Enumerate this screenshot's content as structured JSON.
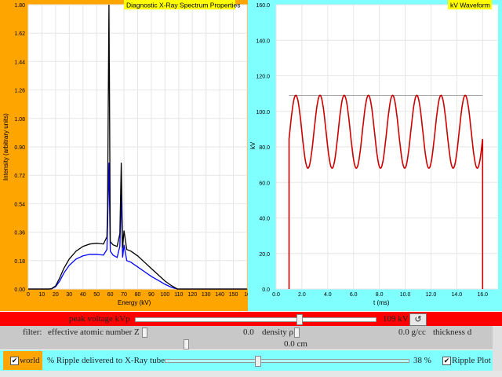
{
  "spectrum_plot": {
    "title": "Diagnostic X-Ray Spectrum Properties",
    "ylabel": "Intensity (arbitrary units)",
    "xlabel": "Energy (kV)",
    "background": "#ffa500",
    "title_bg": "#ffff00",
    "y_ticks": [
      "1.80",
      "1.62",
      "1.44",
      "1.26",
      "1.08",
      "0.90",
      "0.72",
      "0.54",
      "0.36",
      "0.18",
      "0.00"
    ],
    "x_ticks": [
      "0",
      "10",
      "20",
      "30",
      "40",
      "50",
      "60",
      "70",
      "80",
      "90",
      "100",
      "110",
      "120",
      "130",
      "140",
      "150",
      "16"
    ]
  },
  "waveform_plot": {
    "title": "kV Waveform",
    "ylabel": "kV",
    "xlabel": "t (ms)",
    "background": "#80ffff",
    "title_bg": "#ffff00",
    "y_ticks": [
      "160.0",
      "140.0",
      "120.0",
      "100.0",
      "80.0",
      "60.0",
      "40.0",
      "20.0",
      "0.0"
    ],
    "x_ticks": [
      "0.0",
      "2.0",
      "4.0",
      "6.0",
      "8.0",
      "10.0",
      "12.0",
      "14.0",
      "16.0"
    ]
  },
  "kvp_control": {
    "label": "peak voltage kVp",
    "value": "109 kV",
    "reset_icon": "reset-icon",
    "slider_fraction": 0.68
  },
  "filter_controls": {
    "filter_label": "filter:",
    "z_label": "effective atomic number Z",
    "z_value": "0.0",
    "density_label": "density ρ",
    "density_value": "0.0 g/cc",
    "thickness_label": "thickness d",
    "thickness_value": "0.0 cm"
  },
  "ripple_control": {
    "world_label": "world",
    "ripple_label": "% Ripple delivered to X-Ray tube",
    "ripple_value": "38 %",
    "ripple_plot_label": "Ripple Plot",
    "slider_fraction": 0.38
  },
  "chart_data": [
    {
      "type": "line",
      "title": "Diagnostic X-Ray Spectrum Properties",
      "xlabel": "Energy (kV)",
      "ylabel": "Intensity (arbitrary units)",
      "xlim": [
        0,
        160
      ],
      "ylim": [
        0,
        1.8
      ],
      "grid": true,
      "series": [
        {
          "color": "#000000",
          "x": [
            0,
            15,
            17,
            20,
            23,
            26,
            30,
            35,
            40,
            45,
            50,
            55,
            57.5,
            58,
            59,
            60,
            62,
            65,
            67,
            68,
            69,
            70,
            72,
            75,
            80,
            85,
            90,
            95,
            100,
            105,
            109,
            115,
            160
          ],
          "y": [
            0,
            0,
            0.002,
            0.02,
            0.07,
            0.13,
            0.19,
            0.24,
            0.27,
            0.285,
            0.29,
            0.285,
            0.33,
            0.5,
            1.8,
            0.3,
            0.28,
            0.27,
            0.35,
            0.8,
            0.26,
            0.37,
            0.25,
            0.24,
            0.21,
            0.17,
            0.13,
            0.09,
            0.05,
            0.02,
            0,
            0,
            0
          ]
        },
        {
          "color": "#0000ff",
          "x": [
            0,
            15,
            17,
            20,
            23,
            26,
            30,
            35,
            40,
            45,
            50,
            55,
            57.5,
            58,
            59,
            60,
            62,
            65,
            67,
            68,
            69,
            70,
            72,
            75,
            80,
            85,
            90,
            95,
            100,
            105,
            109,
            115,
            160
          ],
          "y": [
            0,
            0,
            0.001,
            0.015,
            0.05,
            0.1,
            0.15,
            0.19,
            0.21,
            0.22,
            0.22,
            0.215,
            0.25,
            0.4,
            0.8,
            0.24,
            0.215,
            0.2,
            0.27,
            0.6,
            0.2,
            0.28,
            0.18,
            0.17,
            0.14,
            0.11,
            0.08,
            0.055,
            0.03,
            0.01,
            0,
            0,
            0
          ]
        }
      ]
    },
    {
      "type": "line",
      "title": "kV Waveform",
      "xlabel": "t (ms)",
      "ylabel": "kV",
      "xlim": [
        0,
        17.2
      ],
      "ylim": [
        0,
        160
      ],
      "grid": true,
      "series": [
        {
          "color": "#cc0000",
          "function": "kVp*(1 - r/2) + (kVp*r/2)*|cos(2*pi*60*t)| style ripple",
          "kvp": 109,
          "ripple_percent": 38,
          "t_start": 1.0,
          "t_end": 16.0,
          "max": 109,
          "min": 68,
          "cycles": 8
        }
      ],
      "reference_line": {
        "y": 109,
        "color": "#888888"
      }
    }
  ]
}
